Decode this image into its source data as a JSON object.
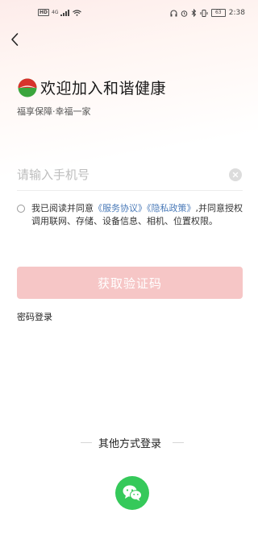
{
  "status_bar": {
    "hd_label": "HD",
    "signal_label": "4G",
    "battery_level": "63",
    "time": "2:38"
  },
  "header": {
    "title": "欢迎加入和谐健康",
    "subtitle": "福享保障·幸福一家"
  },
  "form": {
    "phone_placeholder": "请输入手机号",
    "phone_value": "",
    "agreement": {
      "checked": false,
      "prefix": "我已阅读并同意",
      "service_link": "《服务协议》",
      "privacy_link": "《隐私政策》",
      "suffix": ",并同意授权调用联网、存储、设备信息、相机、位置权限。"
    },
    "get_code_label": "获取验证码",
    "password_login_label": "密码登录"
  },
  "other_login": {
    "label": "其他方式登录",
    "wechat_icon": "wechat-icon"
  },
  "colors": {
    "accent_link": "#4a7ab8",
    "button_disabled": "#f6c6c6",
    "wechat_green": "#35c95a",
    "logo_red": "#d8322c",
    "logo_green": "#3aa53c"
  }
}
